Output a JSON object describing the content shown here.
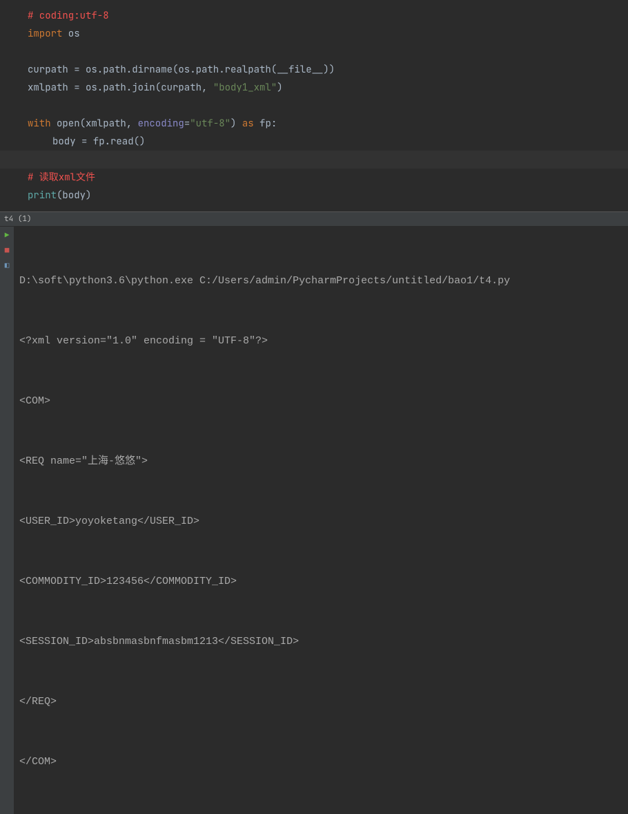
{
  "editor": {
    "lines": {
      "comment1": "# coding:utf-8",
      "kw_import": "import",
      "mod_os": " os",
      "var_curpath": "curpath ",
      "eq": "=",
      "os_path1": " os.path.dirname(os.path.realpath(__file__))",
      "var_xmlpath": "xmlpath ",
      "os_path2_a": " os.path.join(curpath, ",
      "str_body1": "\"body1_xml\"",
      "os_path2_b": ")",
      "kw_with": "with",
      "open_a": " open(xmlpath, ",
      "param_encoding": "encoding",
      "eq_tight": "=",
      "str_utf8": "\"utf-8\"",
      "open_b": ") ",
      "kw_as": "as",
      "fp_colon": " fp:",
      "body_assign": "body ",
      "fp_read": " fp.read()",
      "comment2": "# 读取xml文件",
      "print_name": "print",
      "print_arg": "(body)"
    }
  },
  "tab": {
    "label": "t4 (1)"
  },
  "console": {
    "lines": [
      "D:\\soft\\python3.6\\python.exe C:/Users/admin/PycharmProjects/untitled/bao1/t4.py",
      "<?xml version=\"1.0\" encoding = \"UTF-8\"?>",
      "<COM>",
      "<REQ name=\"上海-悠悠\">",
      "<USER_ID>yoyoketang</USER_ID>",
      "<COMMODITY_ID>123456</COMMODITY_ID>",
      "<SESSION_ID>absbnmasbnfmasbm1213</SESSION_ID>",
      "</REQ>",
      "</COM>"
    ]
  },
  "gutter": {
    "icons": [
      "rerun",
      "stop",
      "restore"
    ]
  }
}
